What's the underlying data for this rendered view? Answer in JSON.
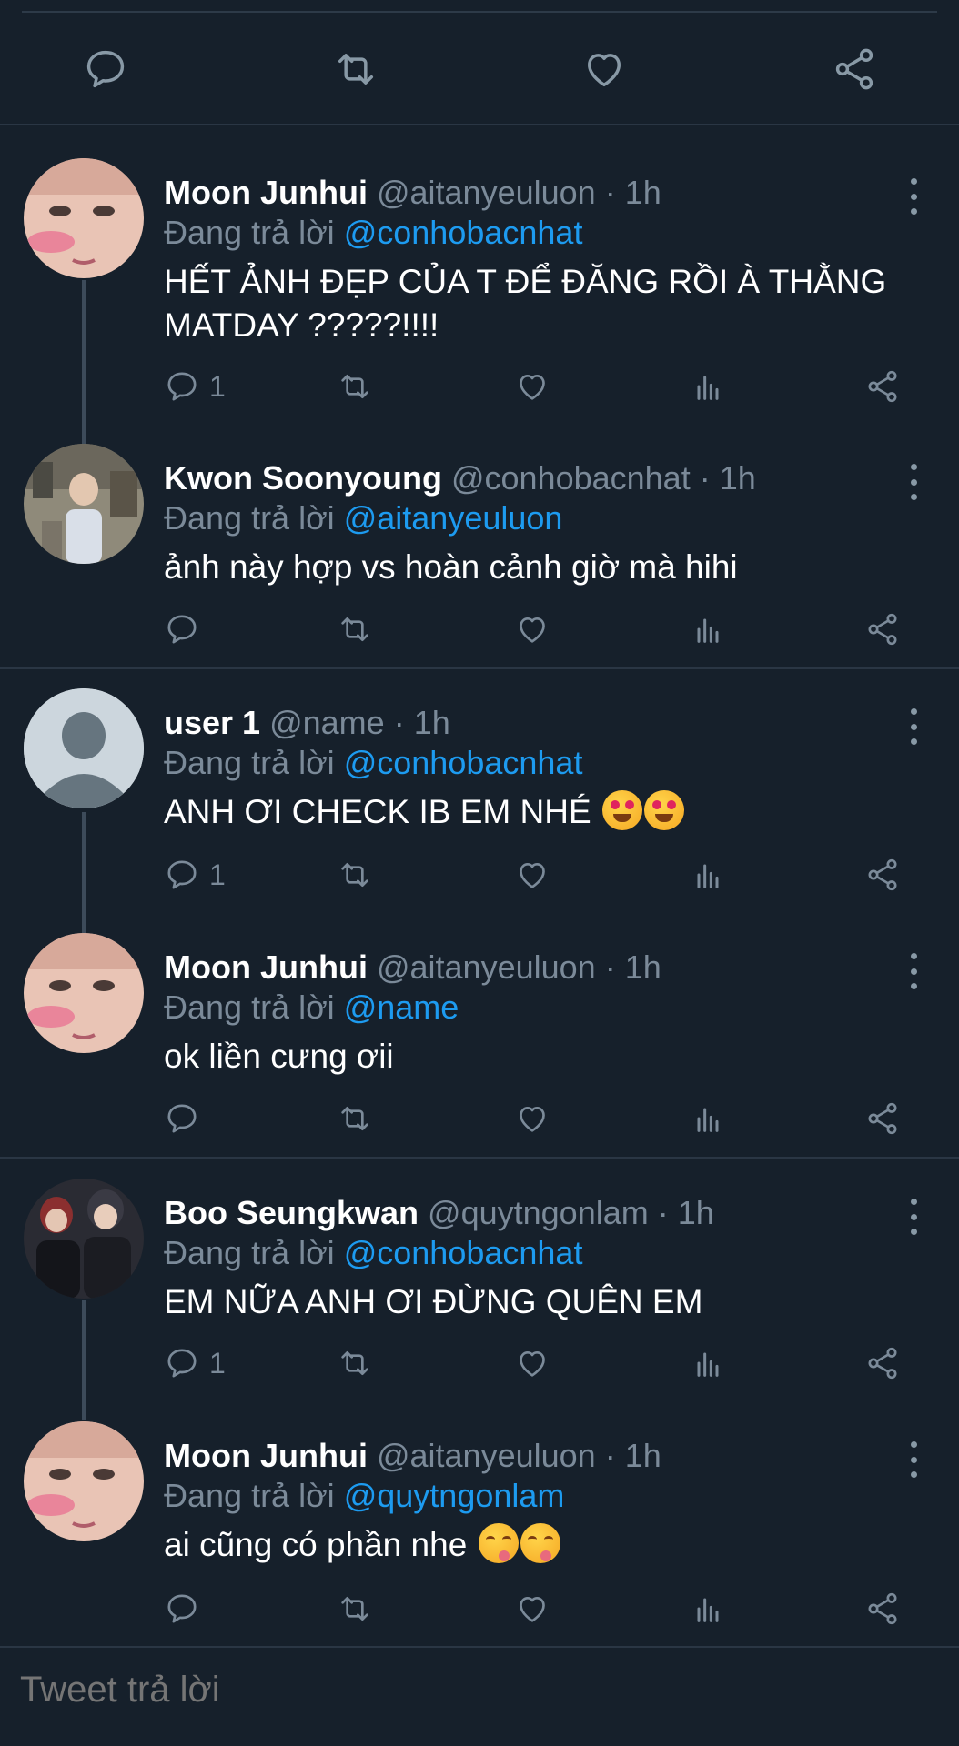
{
  "reply_prefix": "Đang trả lời",
  "colors": {
    "background": "#16202b",
    "mention": "#1d9bf0",
    "muted": "#7b8a99"
  },
  "tweets": [
    {
      "name": "Moon Junhui",
      "handle": "@aitanyeuluon",
      "time": "1h",
      "reply_to": "@conhobacnhat",
      "text": "HẾT ẢNH ĐẸP CỦA T ĐỂ ĐĂNG RỒI À THẰNG MATDAY ?????!!!!",
      "reply_count": "1",
      "avatar": "portrait-avatar"
    },
    {
      "name": "Kwon Soonyoung",
      "handle": "@conhobacnhat",
      "time": "1h",
      "reply_to": "@aitanyeuluon",
      "text": "ảnh này hợp vs hoàn cảnh giờ mà hihi",
      "reply_count": "",
      "avatar": "photo-avatar"
    },
    {
      "name": "user 1",
      "handle": "@name",
      "time": "1h",
      "reply_to": "@conhobacnhat",
      "text": "ANH ƠI CHECK IB EM NHÉ",
      "reply_count": "1",
      "avatar": "default-avatar"
    },
    {
      "name": "Moon Junhui",
      "handle": "@aitanyeuluon",
      "time": "1h",
      "reply_to": "@name",
      "text": "ok liền cưng ơii",
      "reply_count": "",
      "avatar": "portrait-avatar"
    },
    {
      "name": "Boo Seungkwan",
      "handle": "@quytngonlam",
      "time": "1h",
      "reply_to": "@conhobacnhat",
      "text": "EM NỮA ANH ƠI ĐỪNG QUÊN EM",
      "reply_count": "1",
      "avatar": "photo-avatar-dark"
    },
    {
      "name": "Moon Junhui",
      "handle": "@aitanyeuluon",
      "time": "1h",
      "reply_to": "@quytngonlam",
      "text": "ai cũng có phần nhe",
      "reply_count": "",
      "avatar": "portrait-avatar"
    }
  ],
  "compose": {
    "placeholder": "Tweet trả lời"
  }
}
